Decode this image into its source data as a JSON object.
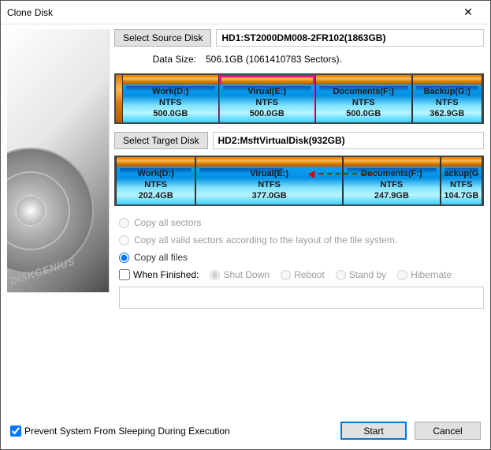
{
  "window": {
    "title": "Clone Disk"
  },
  "sourceSection": {
    "buttonLabel": "Select Source Disk",
    "diskLabel": "HD1:ST2000DM008-2FR102(1863GB)",
    "dataSizeLabel": "Data Size:",
    "dataSizeValue": "506.1GB (1061410783 Sectors).",
    "partitions": [
      {
        "name": "Work(D:)",
        "fs": "NTFS",
        "size": "500.0GB",
        "flex": 113
      },
      {
        "name": "Virual(E:)",
        "fs": "NTFS",
        "size": "500.0GB",
        "flex": 113,
        "selected": true
      },
      {
        "name": "Documents(F:)",
        "fs": "NTFS",
        "size": "500.0GB",
        "flex": 113
      },
      {
        "name": "Backup(G:)",
        "fs": "NTFS",
        "size": "362.9GB",
        "flex": 82
      }
    ]
  },
  "targetSection": {
    "buttonLabel": "Select Target Disk",
    "diskLabel": "HD2:MsftVirtualDisk(932GB)",
    "partitions": [
      {
        "name": "Work(D:)",
        "fs": "NTFS",
        "size": "202.4GB",
        "flex": 93
      },
      {
        "name": "Virual(E:)",
        "fs": "NTFS",
        "size": "377.0GB",
        "flex": 173,
        "arrow": true
      },
      {
        "name": "Documents(F:)",
        "fs": "NTFS",
        "size": "247.9GB",
        "flex": 114
      },
      {
        "name": "ackup(G",
        "fs": "NTFS",
        "size": "104.7GB",
        "flex": 48,
        "clipped": true
      }
    ]
  },
  "copyOptions": {
    "allSectors": "Copy all sectors",
    "validSectors": "Copy all valid sectors according to the layout of the file system.",
    "allFiles": "Copy all files",
    "selected": "allFiles"
  },
  "whenFinished": {
    "label": "When Finished:",
    "checked": false,
    "options": {
      "shutdown": "Shut Down",
      "reboot": "Reboot",
      "standby": "Stand by",
      "hibernate": "Hibernate"
    }
  },
  "footer": {
    "preventSleepLabel": "Prevent System From Sleeping During Execution",
    "preventSleepChecked": true,
    "start": "Start",
    "cancel": "Cancel"
  },
  "brand": "DISKGENIUS"
}
